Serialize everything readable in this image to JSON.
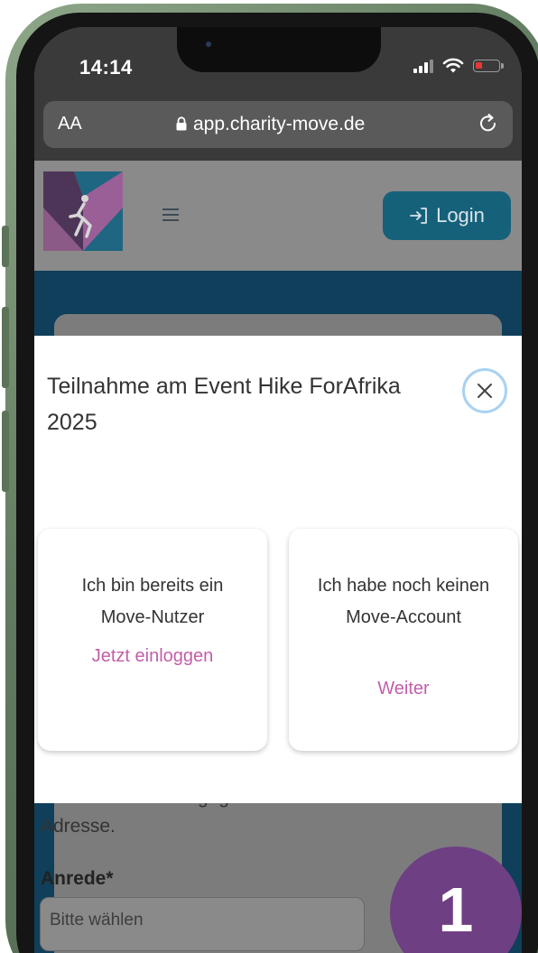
{
  "status_bar": {
    "time": "14:14"
  },
  "browser": {
    "text_size_label": "AA",
    "url": "app.charity-move.de",
    "icons": [
      "lock-icon",
      "reload-icon"
    ]
  },
  "header": {
    "login_label": "Login",
    "icons": [
      "hamburger-menu-icon",
      "login-arrow-icon"
    ]
  },
  "modal": {
    "title": "Teilnahme am Event Hike ForAfrika 2025",
    "close_icon": "close-icon",
    "options": [
      {
        "text": "Ich bin bereits ein Move-Nutzer",
        "link": "Jetzt einloggen"
      },
      {
        "text": "Ich habe noch keinen Move-Account",
        "link": "Weiter"
      }
    ]
  },
  "page": {
    "info_text": "über die von dir angegebene E-Mail-Adresse.",
    "anrede_label": "Anrede*",
    "anrede_placeholder": "Bitte wählen"
  },
  "badge": {
    "step": "1"
  },
  "colors": {
    "accent_pink": "#c25ea8",
    "login_button": "#16617a",
    "badge": "#6e3f83",
    "page_background": "#0f3f5a",
    "close_ring": "#a8d2f2"
  }
}
